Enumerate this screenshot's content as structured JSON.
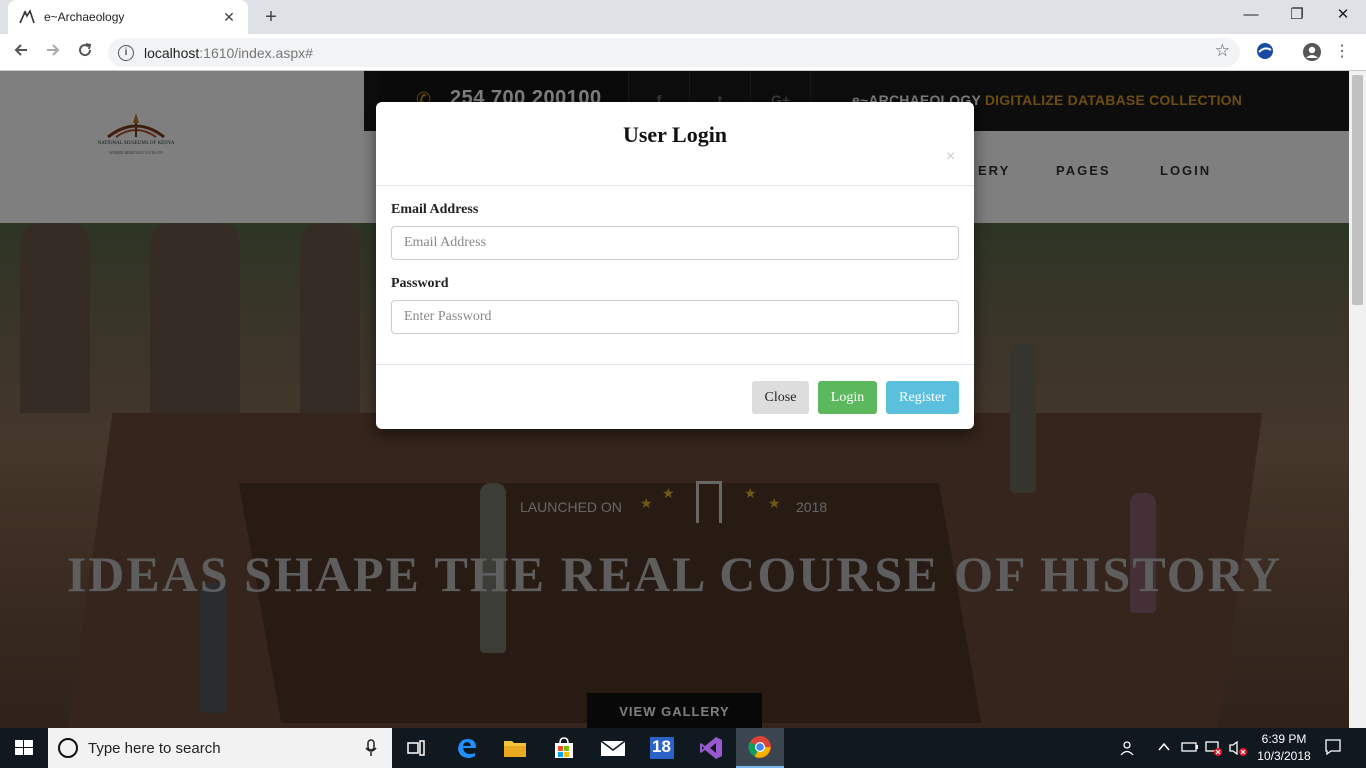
{
  "browser": {
    "tab_title": "e~Archaeology",
    "url_host": "localhost",
    "url_rest": ":1610/index.aspx#",
    "new_tab": "+",
    "minimize": "—",
    "restore": "❐",
    "close": "✕"
  },
  "site": {
    "logo_text": "NATIONAL MUSEUMS OF KENYA",
    "logo_subtext": "WHERE HERITAGE LIVES ON",
    "phone": "254 700 200100",
    "social": [
      "f",
      "t",
      "G+"
    ],
    "tagline_white": "e~ARCHAEOLOGY",
    "tagline_accent": "DIGITALIZE DATABASE COLLECTION",
    "nav": [
      "ERY",
      "PAGES",
      "LOGIN"
    ],
    "launched_label": "LAUNCHED ON",
    "launched_year": "2018",
    "hero_title": "IDEAS SHAPE THE REAL COURSE OF HISTORY",
    "gallery_button": "VIEW GALLERY"
  },
  "modal": {
    "title": "User Login",
    "close_x": "×",
    "email_label": "Email Address",
    "email_placeholder": "Email Address",
    "email_value": "",
    "password_label": "Password",
    "password_placeholder": "Enter Password",
    "password_value": "",
    "btn_close": "Close",
    "btn_login": "Login",
    "btn_register": "Register"
  },
  "taskbar": {
    "search_placeholder": "Type here to search",
    "calendar_badge": "18",
    "time": "6:39 PM",
    "date": "10/3/2018"
  },
  "colors": {
    "accent_gold": "#d89a2a",
    "login_green": "#5cb85c",
    "register_blue": "#5bc0de"
  }
}
